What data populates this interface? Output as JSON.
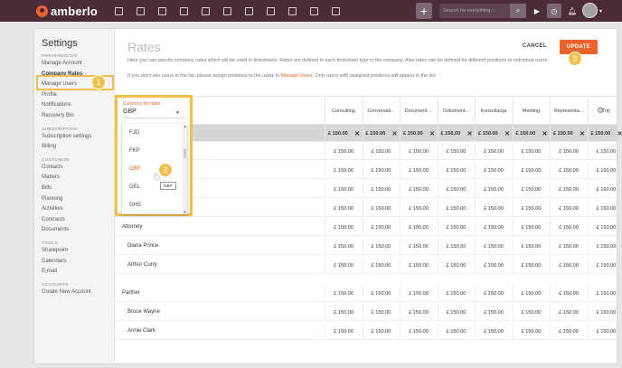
{
  "app": {
    "name": "amberlo"
  },
  "topbar": {
    "search_placeholder": "Search for everything...",
    "plus_label": "+",
    "search_icon": "search-icon",
    "play_icon": "play-icon",
    "timer_icon": "timer-icon",
    "bell_icon": "bell-icon",
    "avatar_caret": "▾",
    "accent": "#e9632c",
    "bar_color": "#4a2c38"
  },
  "sidebar": {
    "title": "Settings",
    "groups": [
      {
        "label": "PREFERENCES",
        "items": [
          "Manage Account",
          "Company Rates",
          "Manage Users",
          "Profile",
          "Notifications",
          "Recovery Bin"
        ]
      },
      {
        "label": "SUBSCRIPTION",
        "items": [
          "Subscription settings",
          "Billing"
        ]
      },
      {
        "label": "CUSTOMIZE",
        "items": [
          "Contacts",
          "Matters",
          "Bills",
          "Planning",
          "Activities",
          "Contracts",
          "Documents"
        ]
      },
      {
        "label": "TOOLS",
        "items": [
          "Sharepoint",
          "Calendars",
          "E-mail"
        ]
      },
      {
        "label": "ACCOUNTS",
        "items": [
          "Create New Account"
        ]
      }
    ],
    "active_item": "Company Rates"
  },
  "main": {
    "title": "Rates",
    "description": "Here you can specify company rates which will be used in timesheets. Rates are defined to each timesheet type in the company. Also rates can be defined for different positions or individual users",
    "note_prefix": "If you don't see users in the list, please assign positions to the users in ",
    "note_link": "Manage Users",
    "note_suffix": ". Only users with assigned positions will appear in the list.",
    "cancel_label": "CANCEL",
    "update_label": "UPDATE"
  },
  "currency": {
    "label": "Currency for rates",
    "value": "GBP",
    "options": [
      "FJD",
      "FKP",
      "GBP",
      "GEL",
      "GHS"
    ],
    "selected": "GBP",
    "tooltip": "GBP"
  },
  "table": {
    "columns": [
      "Consulting",
      "Conversati...",
      "Document ...",
      "Dokument...",
      "Konsultacija",
      "Meeting",
      "Representa...",
      "Trip"
    ],
    "rate_value": "£ 150.00",
    "remove_glyph": "✕",
    "rows": [
      {
        "type": "rate",
        "label": ""
      },
      {
        "type": "user",
        "label": ""
      },
      {
        "type": "user",
        "label": ""
      },
      {
        "type": "group",
        "label": ""
      },
      {
        "type": "user",
        "label": ""
      },
      {
        "type": "group",
        "label": "Attorney"
      },
      {
        "type": "user",
        "label": "Diana Prince"
      },
      {
        "type": "user",
        "label": "Arthur Curry"
      },
      {
        "type": "spacer",
        "label": ""
      },
      {
        "type": "group",
        "label": "Partner"
      },
      {
        "type": "user",
        "label": "Bruce Wayne"
      },
      {
        "type": "user",
        "label": "Annie Clark"
      }
    ]
  },
  "steps": [
    "1",
    "2",
    "3"
  ]
}
